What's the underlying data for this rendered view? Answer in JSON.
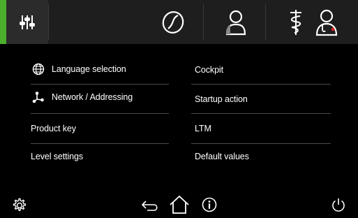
{
  "topbar": {
    "accent_color": "#4caf2c",
    "tabs": [
      {
        "name": "settings-sliders-icon",
        "active": true
      },
      {
        "name": "coffee-bean-icon"
      },
      {
        "name": "user-profile-icon"
      },
      {
        "name": "service-caduceus-icon"
      },
      {
        "name": "doctor-user-icon"
      }
    ]
  },
  "menu": {
    "left": [
      {
        "label": "Language selection",
        "icon": "globe-icon"
      },
      {
        "label": "Network / Addressing",
        "icon": "network-icon"
      },
      {
        "label": "Product key"
      },
      {
        "label": "Level settings"
      }
    ],
    "right": [
      {
        "label": "Cockpit"
      },
      {
        "label": "Startup action"
      },
      {
        "label": "LTM"
      },
      {
        "label": "Default values"
      }
    ]
  },
  "bottom": {
    "icons": [
      "gear-icon",
      "back-arrow-icon",
      "home-icon",
      "info-icon",
      "power-icon"
    ]
  }
}
